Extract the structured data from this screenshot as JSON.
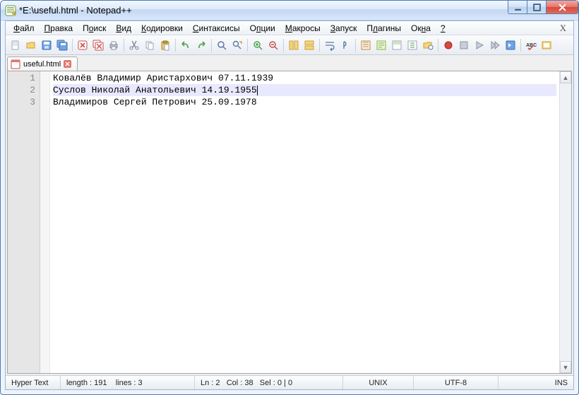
{
  "window": {
    "title": "*E:\\useful.html - Notepad++"
  },
  "menu": {
    "file": "Файл",
    "edit": "Правка",
    "search": "Поиск",
    "view": "Вид",
    "encoding": "Кодировки",
    "syntax": "Синтаксисы",
    "options": "Опции",
    "macros": "Макросы",
    "run": "Запуск",
    "plugins": "Плагины",
    "windows": "Окна",
    "help": "?"
  },
  "tabs": [
    {
      "label": "useful.html"
    }
  ],
  "editor": {
    "lines": [
      "Ковалёв Владимир Аристархович 07.11.1939",
      "Суслов Николай Анатольевич 14.19.1955",
      "Владимиров Сергей Петрович 25.09.1978"
    ],
    "current_line": 2
  },
  "status": {
    "filetype": "Hyper Text",
    "length": "length : 191",
    "lines": "lines : 3",
    "ln": "Ln : 2",
    "col": "Col : 38",
    "sel": "Sel : 0 | 0",
    "eol": "UNIX",
    "encoding": "UTF-8",
    "mode": "INS"
  },
  "colors": {
    "accent": "#3a6ea5"
  }
}
